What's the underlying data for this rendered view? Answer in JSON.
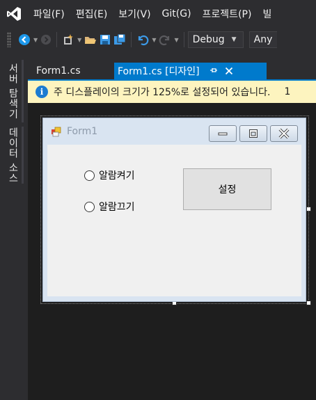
{
  "menu": {
    "items": [
      "파일(F)",
      "편집(E)",
      "보기(V)",
      "Git(G)",
      "프로젝트(P)",
      "빌"
    ]
  },
  "toolbar": {
    "config_combo": "Debug",
    "platform_combo": "Any"
  },
  "side_tabs": {
    "server_explorer": "서버 탐색기",
    "data_sources": "데이터 소스"
  },
  "doc_tabs": {
    "code_tab": "Form1.cs",
    "design_tab": "Form1.cs [디자인]",
    "pin_icon": "pin-icon",
    "close_icon": "close-icon"
  },
  "infobar": {
    "message": "주 디스플레이의 크기가 125%로 설정되어 있습니다.",
    "extra": "1"
  },
  "form": {
    "title": "Form1",
    "radio_on": "알람켜기",
    "radio_off": "알람끄기",
    "set_button": "설정"
  },
  "colors": {
    "accent": "#007acc",
    "chrome": "#2d2d30",
    "background": "#1e1e1e",
    "infobar": "#fdf4bf"
  }
}
